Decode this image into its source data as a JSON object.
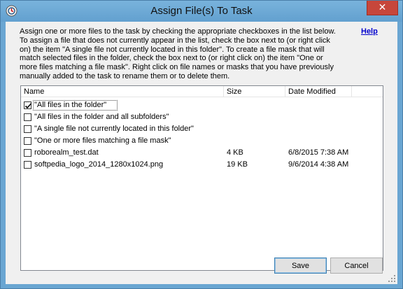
{
  "window": {
    "title": "Assign File(s) To Task",
    "close_glyph": "✕"
  },
  "description": "Assign one or more files to the task by checking the appropriate checkboxes in the list below. To assign a file that does not currently appear in the list, check the box next to (or right click on) the item \"A single file not currently located in this folder\". To create a file mask that will match selected files in the folder, check the box next to (or right click on) the item \"One or more files matching a file mask\". Right click on file names or masks that you have previously manually added to the task to rename them or to delete them.",
  "help_label": "Help",
  "list": {
    "columns": {
      "name": "Name",
      "size": "Size",
      "date": "Date Modified"
    },
    "rows": [
      {
        "name": "\"All files in the folder\"",
        "size": "",
        "date": "",
        "checked": true
      },
      {
        "name": "\"All files in the folder and all subfolders\"",
        "size": "",
        "date": "",
        "checked": false
      },
      {
        "name": "\"A single file not currently located in this folder\"",
        "size": "",
        "date": "",
        "checked": false
      },
      {
        "name": "\"One or more files matching a file mask\"",
        "size": "",
        "date": "",
        "checked": false
      },
      {
        "name": "roborealm_test.dat",
        "size": "4 KB",
        "date": "6/8/2015 7:38 AM",
        "checked": false
      },
      {
        "name": "softpedia_logo_2014_1280x1024.png",
        "size": "19 KB",
        "date": "9/6/2014 4:38 AM",
        "checked": false
      }
    ]
  },
  "buttons": {
    "save": "Save",
    "cancel": "Cancel"
  },
  "colors": {
    "title_bar": "#6aa6d2",
    "close": "#c7463b",
    "link": "#0000cc"
  },
  "icons": {
    "app": "app-icon",
    "close": "close-icon",
    "check": "checkmark-icon",
    "grip": "resize-grip-icon"
  }
}
